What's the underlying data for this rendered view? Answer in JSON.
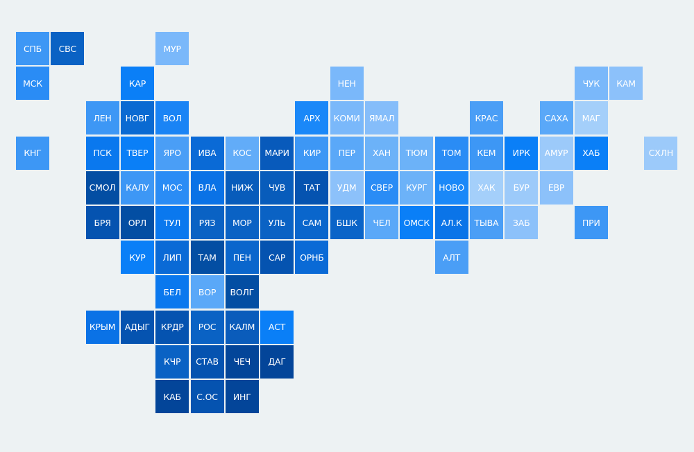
{
  "map": {
    "regions": [
      {
        "label": "СПБ",
        "color": "#3d97f5"
      },
      {
        "label": "СВС",
        "color": "#0a62c4"
      },
      {
        "label": "МУР",
        "color": "#7ab8fa"
      },
      {
        "label": "МСК",
        "color": "#2a8cf5"
      },
      {
        "label": "КАР",
        "color": "#0a7ff7"
      },
      {
        "label": "НЕН",
        "color": "#7ab8fa"
      },
      {
        "label": "ЧУК",
        "color": "#7ab8fa"
      },
      {
        "label": "КАМ",
        "color": "#8cc1fa"
      },
      {
        "label": "ЛЕН",
        "color": "#3d97f5"
      },
      {
        "label": "НОВГ",
        "color": "#0a6ad2"
      },
      {
        "label": "ВОЛ",
        "color": "#1a84f5"
      },
      {
        "label": "АРХ",
        "color": "#1a88f8"
      },
      {
        "label": "КОМИ",
        "color": "#7ab8fa"
      },
      {
        "label": "ЯМАЛ",
        "color": "#85bdfa"
      },
      {
        "label": "КРАС",
        "color": "#4a9ef6"
      },
      {
        "label": "САХА",
        "color": "#5aa8f8"
      },
      {
        "label": "МАГ",
        "color": "#a4cffa"
      },
      {
        "label": "КНГ",
        "color": "#3d97f5"
      },
      {
        "label": "ПСК",
        "color": "#0a78ee"
      },
      {
        "label": "ТВЕР",
        "color": "#0a7ff7"
      },
      {
        "label": "ЯРО",
        "color": "#4a9ef6"
      },
      {
        "label": "ИВА",
        "color": "#0a6ad6"
      },
      {
        "label": "КОС",
        "color": "#62acf8"
      },
      {
        "label": "МАРИ",
        "color": "#085abb"
      },
      {
        "label": "КИР",
        "color": "#3d97f5"
      },
      {
        "label": "ПЕР",
        "color": "#5aa8f8"
      },
      {
        "label": "ХАН",
        "color": "#6cb2f8"
      },
      {
        "label": "ТЮМ",
        "color": "#6cb2f8"
      },
      {
        "label": "ТОМ",
        "color": "#2a8cf5"
      },
      {
        "label": "КЕМ",
        "color": "#3d97f5"
      },
      {
        "label": "ИРК",
        "color": "#0a7ff7"
      },
      {
        "label": "АМУР",
        "color": "#9ccafa"
      },
      {
        "label": "ХАБ",
        "color": "#0a7ff7"
      },
      {
        "label": "СХЛН",
        "color": "#9ccafa"
      },
      {
        "label": "СМОЛ",
        "color": "#034ea3"
      },
      {
        "label": "КАЛУ",
        "color": "#3d97f5"
      },
      {
        "label": "МОС",
        "color": "#2a8cf5"
      },
      {
        "label": "ВЛА",
        "color": "#0a72e6"
      },
      {
        "label": "НИЖ",
        "color": "#085cbb"
      },
      {
        "label": "ЧУВ",
        "color": "#085cbb"
      },
      {
        "label": "ТАТ",
        "color": "#0553b0"
      },
      {
        "label": "УДМ",
        "color": "#8cc1fa"
      },
      {
        "label": "СВЕР",
        "color": "#2a8cf5"
      },
      {
        "label": "КУРГ",
        "color": "#6cb2f8"
      },
      {
        "label": "НОВО",
        "color": "#1a88f8"
      },
      {
        "label": "ХАК",
        "color": "#a4cffa"
      },
      {
        "label": "БУР",
        "color": "#9ccafa"
      },
      {
        "label": "ЕВР",
        "color": "#8cc1fa"
      },
      {
        "label": "БРЯ",
        "color": "#0553b0"
      },
      {
        "label": "ОРЛ",
        "color": "#034ea3"
      },
      {
        "label": "ТУЛ",
        "color": "#0a78ee"
      },
      {
        "label": "РЯЗ",
        "color": "#0a62c4"
      },
      {
        "label": "МОР",
        "color": "#0a62c4"
      },
      {
        "label": "УЛЬ",
        "color": "#0a62c4"
      },
      {
        "label": "САМ",
        "color": "#0a66cc"
      },
      {
        "label": "БШК",
        "color": "#0a64c8"
      },
      {
        "label": "ЧЕЛ",
        "color": "#5aa8f8"
      },
      {
        "label": "ОМСК",
        "color": "#0a7ff7"
      },
      {
        "label": "АЛ.К",
        "color": "#0a74e8"
      },
      {
        "label": "ТЫВА",
        "color": "#4a9ef6"
      },
      {
        "label": "ЗАБ",
        "color": "#8cc1fa"
      },
      {
        "label": "ПРИ",
        "color": "#3d97f5"
      },
      {
        "label": "КУР",
        "color": "#0a7ff7"
      },
      {
        "label": "ЛИП",
        "color": "#0a6ad6"
      },
      {
        "label": "ТАМ",
        "color": "#034ea3"
      },
      {
        "label": "ПЕН",
        "color": "#0a66cc"
      },
      {
        "label": "САР",
        "color": "#0553b0"
      },
      {
        "label": "ОРНБ",
        "color": "#0a6ad6"
      },
      {
        "label": "АЛТ",
        "color": "#4a9ef6"
      },
      {
        "label": "БЕЛ",
        "color": "#0a78ee"
      },
      {
        "label": "ВОР",
        "color": "#5aa8f8"
      },
      {
        "label": "ВОЛГ",
        "color": "#034ea3"
      },
      {
        "label": "КРЫМ",
        "color": "#0a72e6"
      },
      {
        "label": "АДЫГ",
        "color": "#0553b0"
      },
      {
        "label": "КРДР",
        "color": "#0553b0"
      },
      {
        "label": "РОС",
        "color": "#0a62c4"
      },
      {
        "label": "КАЛМ",
        "color": "#0a5cbb"
      },
      {
        "label": "АСТ",
        "color": "#0a7ff7"
      },
      {
        "label": "КЧР",
        "color": "#0a62c4"
      },
      {
        "label": "СТАВ",
        "color": "#0553b0"
      },
      {
        "label": "ЧЕЧ",
        "color": "#034599"
      },
      {
        "label": "ДАГ",
        "color": "#034599"
      },
      {
        "label": "КАБ",
        "color": "#034599"
      },
      {
        "label": "С.ОС",
        "color": "#0553b0"
      },
      {
        "label": "ИНГ",
        "color": "#034599"
      }
    ]
  }
}
